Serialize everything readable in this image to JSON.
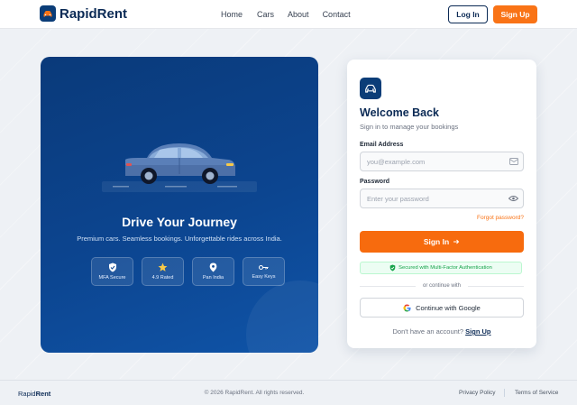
{
  "header": {
    "brand": "RapidRent",
    "nav": [
      "Home",
      "Cars",
      "About",
      "Contact"
    ],
    "login_label": "Log In",
    "signup_label": "Sign Up"
  },
  "hero": {
    "title": "Drive Your Journey",
    "subtitle": "Premium cars. Seamless bookings. Unforgettable rides across India.",
    "badges": [
      {
        "label": "MFA Secure",
        "icon": "shield-check-icon"
      },
      {
        "label": "4.9 Rated",
        "icon": "star-icon"
      },
      {
        "label": "Pan India",
        "icon": "map-pin-icon"
      },
      {
        "label": "Easy Keys",
        "icon": "key-icon"
      }
    ]
  },
  "login": {
    "title": "Welcome Back",
    "subtitle": "Sign in to manage your bookings",
    "email_label": "Email Address",
    "email_placeholder": "you@example.com",
    "password_label": "Password",
    "password_placeholder": "Enter your password",
    "forgot": "Forgot password?",
    "signin_label": "Sign In",
    "mfa_note": "Secured with Multi-Factor Authentication",
    "or_text": "or continue with",
    "google_label": "Continue with Google",
    "no_account": "Don't have an account?",
    "signup_link": "Sign Up"
  },
  "footer": {
    "brand_light": "Rapid",
    "brand_bold": "Rent",
    "copyright": "© 2026 RapidRent. All rights reserved.",
    "privacy": "Privacy Policy",
    "terms": "Terms of Service"
  },
  "colors": {
    "primary": "#0b3d78",
    "accent": "#f97316",
    "success": "#16a34a"
  }
}
